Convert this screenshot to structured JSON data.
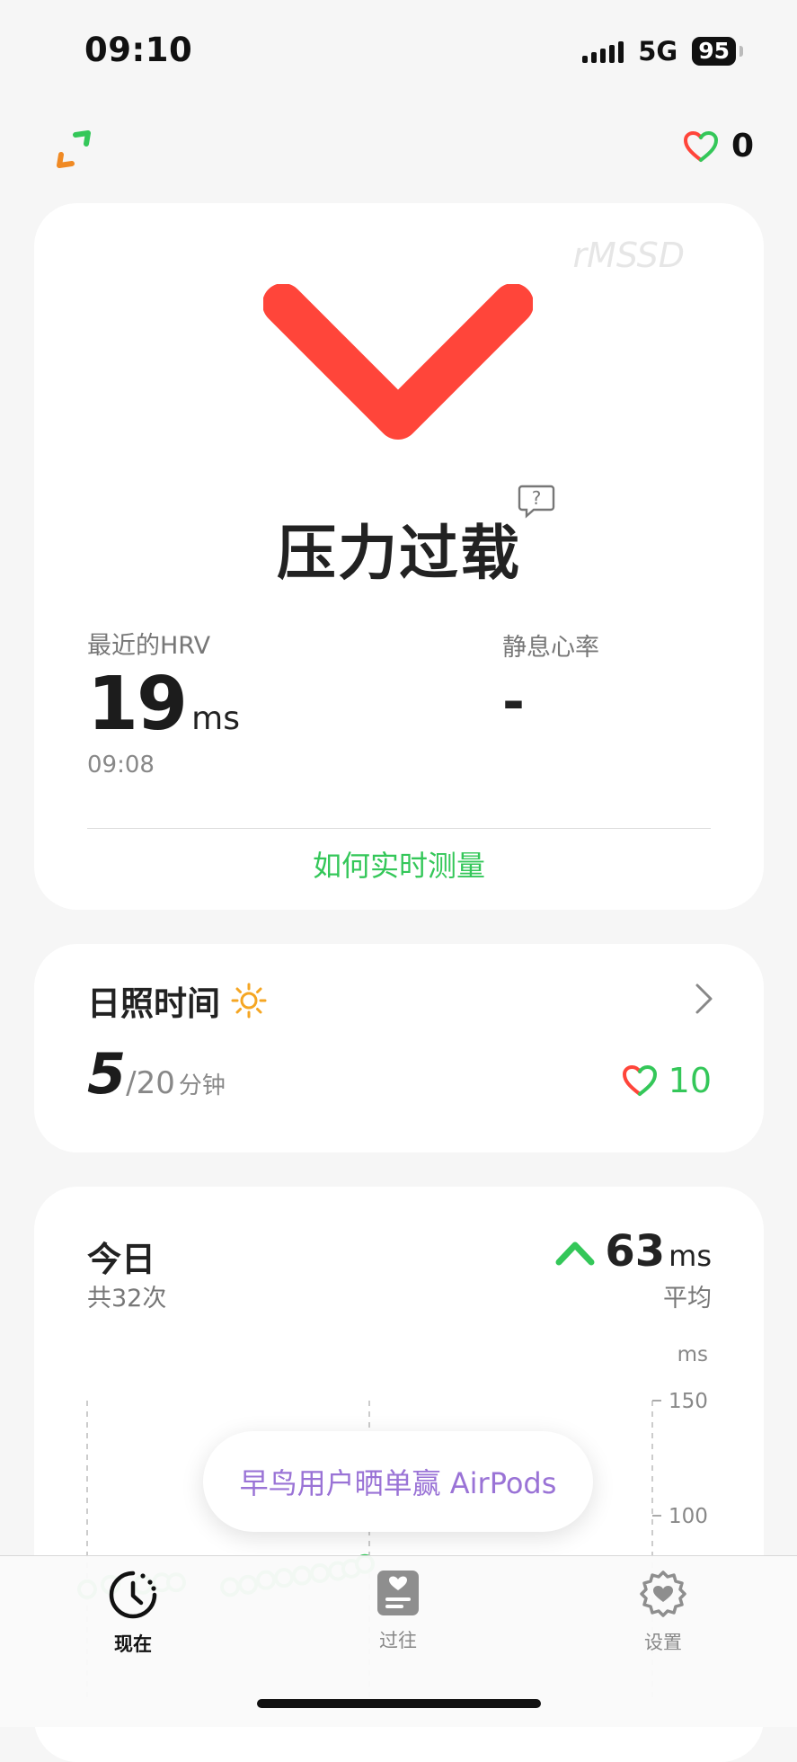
{
  "status_bar": {
    "time": "09:10",
    "network": "5G",
    "battery": "95"
  },
  "header": {
    "heart_points": "0"
  },
  "stress_card": {
    "metric_watermark": "rMSSD",
    "status": "压力过载",
    "hrv_label": "最近的HRV",
    "hrv_value": "19",
    "hrv_unit": "ms",
    "hrv_time": "09:08",
    "resting_hr_label": "静息心率",
    "resting_hr_value": "-",
    "measure_link": "如何实时测量",
    "accent_color": "#ff453a"
  },
  "sunlight_card": {
    "title": "日照时间",
    "value": "5",
    "goal": "/20",
    "unit": "分钟",
    "reward": "10"
  },
  "today_card": {
    "title": "今日",
    "count": "共32次",
    "avg_value": "63",
    "avg_unit": "ms",
    "avg_label": "平均"
  },
  "chart_data": {
    "type": "scatter",
    "ylabel": "ms",
    "yticks": [
      "150",
      "100"
    ],
    "ylim": [
      0,
      150
    ],
    "series": [
      {
        "values": [
          68,
          70,
          70,
          71,
          71,
          69,
          70,
          72,
          73,
          74,
          75,
          76,
          77,
          79
        ]
      }
    ],
    "color": "#34c759"
  },
  "toast": {
    "text": "早鸟用户晒单赢 AirPods"
  },
  "tab_bar": {
    "tabs": [
      {
        "label": "现在"
      },
      {
        "label": "过往"
      },
      {
        "label": "设置"
      }
    ]
  }
}
